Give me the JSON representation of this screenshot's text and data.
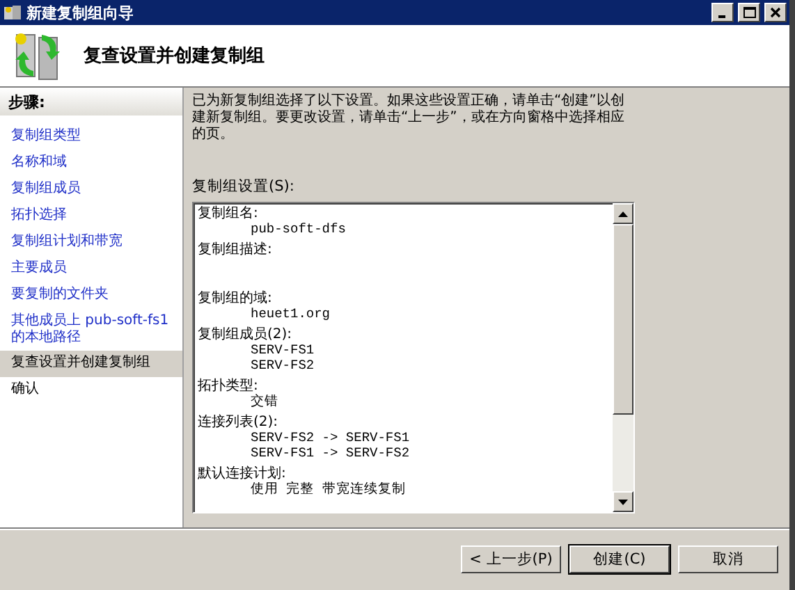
{
  "window": {
    "title": "新建复制组向导"
  },
  "header": {
    "title": "复查设置并创建复制组"
  },
  "steps": {
    "heading": "步骤:",
    "items": [
      {
        "label": "复制组类型",
        "link": true,
        "selected": false
      },
      {
        "label": "名称和域",
        "link": true,
        "selected": false
      },
      {
        "label": "复制组成员",
        "link": true,
        "selected": false
      },
      {
        "label": "拓扑选择",
        "link": true,
        "selected": false
      },
      {
        "label": "复制组计划和带宽",
        "link": true,
        "selected": false
      },
      {
        "label": "主要成员",
        "link": true,
        "selected": false
      },
      {
        "label": "要复制的文件夹",
        "link": true,
        "selected": false
      },
      {
        "label": "其他成员上 pub-soft-fs1 的本地路径",
        "link": true,
        "selected": false
      },
      {
        "label": "复查设置并创建复制组",
        "link": false,
        "selected": true
      },
      {
        "label": "确认",
        "link": false,
        "selected": false
      }
    ]
  },
  "intro": "已为新复制组选择了以下设置。如果这些设置正确，请单击“创建”以创建新复制组。要更改设置，请单击“上一步”，或在方向窗格中选择相应的页。",
  "settings": {
    "label": "复制组设置(S):",
    "sections": [
      {
        "label": "复制组名:",
        "values": [
          "pub-soft-dfs"
        ]
      },
      {
        "label": "复制组描述:"
      },
      {
        "label": "复制组的域:",
        "values": [
          "heuet1.org"
        ]
      },
      {
        "label": "复制组成员(2):",
        "values": [
          "SERV-FS1",
          "SERV-FS2"
        ]
      },
      {
        "label": "拓扑类型:",
        "values": [
          "交错"
        ]
      },
      {
        "label": "连接列表(2):",
        "values": [
          "SERV-FS2 -> SERV-FS1",
          "SERV-FS1 -> SERV-FS2"
        ]
      },
      {
        "label": "默认连接计划:",
        "values": [
          "使用 完整 带宽连续复制"
        ]
      }
    ]
  },
  "buttons": [
    {
      "label": "< 上一步(P)",
      "default": false
    },
    {
      "label": "创建(C)",
      "default": true
    },
    {
      "label": "取消",
      "default": false
    }
  ]
}
